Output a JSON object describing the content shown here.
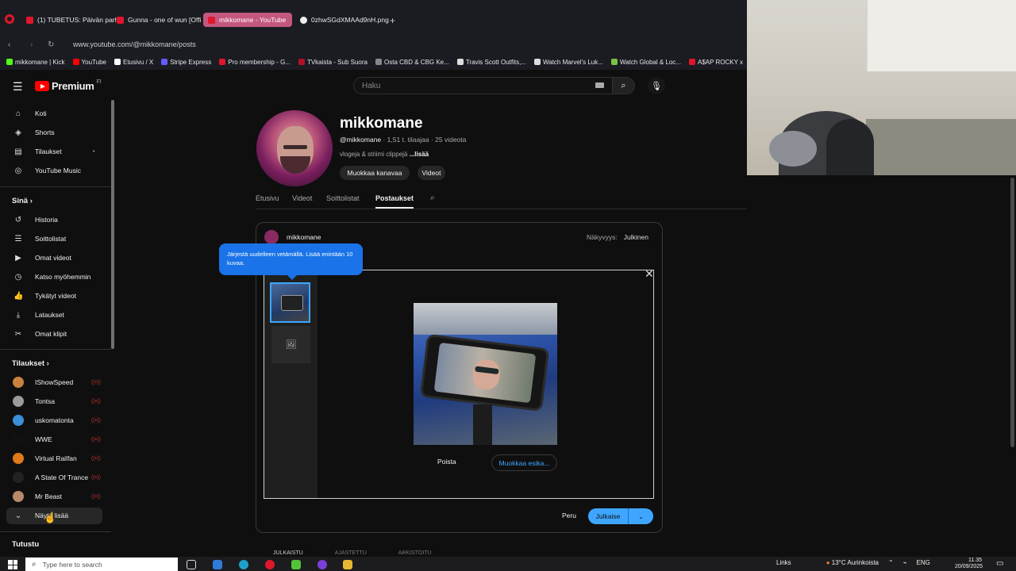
{
  "browser": {
    "tabs": [
      {
        "label": "(1) TUBETUS: Päivän parh",
        "color": "#e0162b"
      },
      {
        "label": "Gunna - one of wun [Offi",
        "color": "#e0162b"
      },
      {
        "label": "mikkomane - YouTube",
        "color": "#e0162b"
      },
      {
        "label": "0zhwSGdXMAAd9nH.png",
        "color": "#eeeeee"
      }
    ],
    "new_tab": "+",
    "url": "www.youtube.com/@mikkomane/posts",
    "bookmarks": [
      {
        "label": "mikkomane | Kick",
        "color": "#53fc18"
      },
      {
        "label": "YouTube",
        "color": "#ff0000"
      },
      {
        "label": "Etusivu / X",
        "color": "#ffffff"
      },
      {
        "label": "Stripe Express",
        "color": "#635bff"
      },
      {
        "label": "Pro membership - G...",
        "color": "#e0162b"
      },
      {
        "label": "TVkaista - Sub Suora",
        "color": "#b0102a"
      },
      {
        "label": "Osta CBD & CBG Ke...",
        "color": "#888888"
      },
      {
        "label": "Travis Scott Outfits,...",
        "color": "#dddddd"
      },
      {
        "label": "Watch Marvel's Luk...",
        "color": "#dddddd"
      },
      {
        "label": "Watch Global & Loc...",
        "color": "#7ac143"
      },
      {
        "label": "A$AP ROCKY x",
        "color": "#e0162b"
      }
    ]
  },
  "youtube": {
    "logo_text": "Premium",
    "logo_region": "FI",
    "search_placeholder": "Haku"
  },
  "sidebar": {
    "main_items": [
      {
        "label": "Koti",
        "icon": "home-icon",
        "glyph": "⌂"
      },
      {
        "label": "Shorts",
        "icon": "shorts-icon",
        "glyph": "◈"
      },
      {
        "label": "Tilaukset",
        "icon": "subscriptions-icon",
        "glyph": "▤",
        "dot": "•"
      },
      {
        "label": "YouTube Music",
        "icon": "music-icon",
        "glyph": "◎"
      }
    ],
    "you_heading": "Sinä",
    "you_items": [
      {
        "label": "Historia",
        "icon": "history-icon",
        "glyph": "↺"
      },
      {
        "label": "Soittolistat",
        "icon": "playlists-icon",
        "glyph": "☰"
      },
      {
        "label": "Omat videot",
        "icon": "your-videos-icon",
        "glyph": "▶"
      },
      {
        "label": "Katso myöhemmin",
        "icon": "watch-later-icon",
        "glyph": "◷"
      },
      {
        "label": "Tykätyt videot",
        "icon": "liked-icon",
        "glyph": "👍"
      },
      {
        "label": "Lataukset",
        "icon": "download-icon",
        "glyph": "⤓"
      },
      {
        "label": "Omat klipit",
        "icon": "clips-icon",
        "glyph": "✂"
      }
    ],
    "subs_heading": "Tilaukset",
    "subscriptions": [
      {
        "label": "IShowSpeed",
        "color": "#c9833c"
      },
      {
        "label": "Tontsa",
        "color": "#9b9b9b"
      },
      {
        "label": "uskomatonta",
        "color": "#3b8ed8"
      },
      {
        "label": "WWE",
        "color": "#111111"
      },
      {
        "label": "Virtual Railfan",
        "color": "#e0781c"
      },
      {
        "label": "A State Of Trance",
        "color": "#222222"
      },
      {
        "label": "Mr Beast",
        "color": "#b98a6a"
      }
    ],
    "show_more": "Näytä lisää",
    "explore_heading": "Tutustu"
  },
  "channel": {
    "name": "mikkomane",
    "handle": "@mikkomane",
    "stats": "· 1,51 t. tilaajaa · 25 videota",
    "description": "vlogeja & striimi clippejä",
    "description_more": "...lisää",
    "customize_button": "Muokkaa kanavaa",
    "videos_button": "Videot",
    "tabs": [
      "Etusivu",
      "Videot",
      "Soittolistat",
      "Postaukset"
    ],
    "active_tab": "Postaukset"
  },
  "post_editor": {
    "username": "mikkomane",
    "visibility_label": "Näkyvyys:",
    "visibility_value": "Julkinen",
    "tooltip": "Järjestä uudelleen vetämällä. Lisää enintään 10 kuvaa.",
    "delete": "Poista",
    "edit_preview": "Muokkaa esika...",
    "cancel": "Peru",
    "publish": "Julkaise",
    "accent": "#3ea6ff"
  },
  "subtabs": [
    "JULKAISTU",
    "AJASTETTU",
    "ARKISTOITU"
  ],
  "taskbar": {
    "search_placeholder": "Type here to search",
    "links": "Links",
    "weather": "13°C Aurinkoista",
    "language": "ENG",
    "time": "11.35",
    "date": "20/09/2025"
  }
}
